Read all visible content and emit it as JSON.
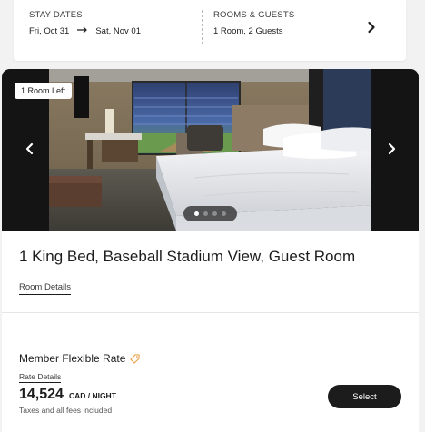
{
  "stay_summary": {
    "dates_label": "STAY DATES",
    "check_in": "Fri, Oct 31",
    "check_out": "Sat, Nov 01",
    "rooms_label": "ROOMS & GUESTS",
    "rooms_value": "1 Room, 2 Guests",
    "icons": {
      "date_arrow": "right-arrow-icon",
      "edit": "chevron-right-icon"
    }
  },
  "room": {
    "availability_badge": "1 Room Left",
    "title": "1 King Bed, Baseball Stadium View, Guest Room",
    "details_link": "Room Details",
    "gallery": {
      "photo_count": 4,
      "active_index": 0
    }
  },
  "rate": {
    "name": "Member Flexible Rate",
    "name_icon": "tag-icon",
    "details_link": "Rate Details",
    "price": "14,524",
    "price_unit": "CAD / NIGHT",
    "fees_note": "Taxes and all fees included",
    "select_label": "Select"
  },
  "colors": {
    "primary_button": "#1c1c1c",
    "tag_icon": "#e8a045",
    "page_background": "#f2f2f2"
  }
}
